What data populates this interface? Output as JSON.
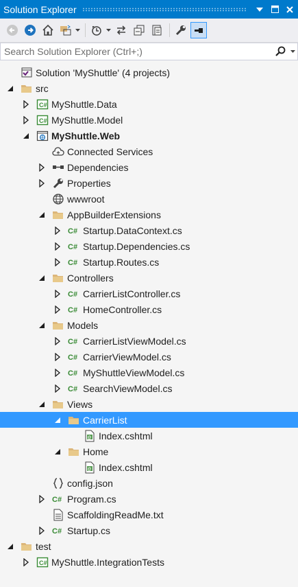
{
  "window": {
    "title": "Solution Explorer"
  },
  "toolbar": {
    "buttons": [
      "back-icon",
      "forward-icon",
      "home-icon",
      "switch-views-icon",
      "pending-changes-icon",
      "sync-icon",
      "collapse-all-icon",
      "show-all-files-icon",
      "properties-icon",
      "preview-icon"
    ]
  },
  "search": {
    "placeholder": "Search Solution Explorer (Ctrl+;)"
  },
  "tree": [
    {
      "label": "Solution 'MyShuttle' (4 projects)",
      "depth": 0,
      "icon": "solution-icon",
      "expander": "none"
    },
    {
      "label": "src",
      "depth": 0,
      "icon": "folder-icon",
      "expander": "expanded"
    },
    {
      "label": "MyShuttle.Data",
      "depth": 1,
      "icon": "csproj-icon",
      "expander": "collapsed"
    },
    {
      "label": "MyShuttle.Model",
      "depth": 1,
      "icon": "csproj-icon",
      "expander": "collapsed"
    },
    {
      "label": "MyShuttle.Web",
      "depth": 1,
      "icon": "webproj-icon",
      "expander": "expanded",
      "bold": true
    },
    {
      "label": "Connected Services",
      "depth": 2,
      "icon": "cloud-icon",
      "expander": "none"
    },
    {
      "label": "Dependencies",
      "depth": 2,
      "icon": "dependencies-icon",
      "expander": "collapsed"
    },
    {
      "label": "Properties",
      "depth": 2,
      "icon": "wrench-icon",
      "expander": "collapsed"
    },
    {
      "label": "wwwroot",
      "depth": 2,
      "icon": "globe-icon",
      "expander": "none"
    },
    {
      "label": "AppBuilderExtensions",
      "depth": 2,
      "icon": "folder-icon",
      "expander": "expanded"
    },
    {
      "label": "Startup.DataContext.cs",
      "depth": 3,
      "icon": "csharp-icon",
      "expander": "collapsed"
    },
    {
      "label": "Startup.Dependencies.cs",
      "depth": 3,
      "icon": "csharp-icon",
      "expander": "collapsed"
    },
    {
      "label": "Startup.Routes.cs",
      "depth": 3,
      "icon": "csharp-icon",
      "expander": "collapsed"
    },
    {
      "label": "Controllers",
      "depth": 2,
      "icon": "folder-icon",
      "expander": "expanded"
    },
    {
      "label": "CarrierListController.cs",
      "depth": 3,
      "icon": "csharp-icon",
      "expander": "collapsed"
    },
    {
      "label": "HomeController.cs",
      "depth": 3,
      "icon": "csharp-icon",
      "expander": "collapsed"
    },
    {
      "label": "Models",
      "depth": 2,
      "icon": "folder-icon",
      "expander": "expanded"
    },
    {
      "label": "CarrierListViewModel.cs",
      "depth": 3,
      "icon": "csharp-icon",
      "expander": "collapsed"
    },
    {
      "label": "CarrierViewModel.cs",
      "depth": 3,
      "icon": "csharp-icon",
      "expander": "collapsed"
    },
    {
      "label": "MyShuttleViewModel.cs",
      "depth": 3,
      "icon": "csharp-icon",
      "expander": "collapsed"
    },
    {
      "label": "SearchViewModel.cs",
      "depth": 3,
      "icon": "csharp-icon",
      "expander": "collapsed"
    },
    {
      "label": "Views",
      "depth": 2,
      "icon": "folder-icon",
      "expander": "expanded"
    },
    {
      "label": "CarrierList",
      "depth": 3,
      "icon": "folder-icon",
      "expander": "expanded",
      "selected": true
    },
    {
      "label": "Index.cshtml",
      "depth": 4,
      "icon": "cshtml-icon",
      "expander": "none"
    },
    {
      "label": "Home",
      "depth": 3,
      "icon": "folder-icon",
      "expander": "expanded"
    },
    {
      "label": "Index.cshtml",
      "depth": 4,
      "icon": "cshtml-icon",
      "expander": "none"
    },
    {
      "label": "config.json",
      "depth": 2,
      "icon": "json-icon",
      "expander": "none"
    },
    {
      "label": "Program.cs",
      "depth": 2,
      "icon": "csharp-icon",
      "expander": "collapsed"
    },
    {
      "label": "ScaffoldingReadMe.txt",
      "depth": 2,
      "icon": "text-file-icon",
      "expander": "none"
    },
    {
      "label": "Startup.cs",
      "depth": 2,
      "icon": "csharp-icon",
      "expander": "collapsed"
    },
    {
      "label": "test",
      "depth": 0,
      "icon": "folder-icon",
      "expander": "expanded"
    },
    {
      "label": "MyShuttle.IntegrationTests",
      "depth": 1,
      "icon": "csproj-icon",
      "expander": "collapsed"
    }
  ],
  "colors": {
    "accent": "#007acc",
    "selection": "#3399ff",
    "folder": "#dcb67a",
    "csharp": "#388a34"
  }
}
